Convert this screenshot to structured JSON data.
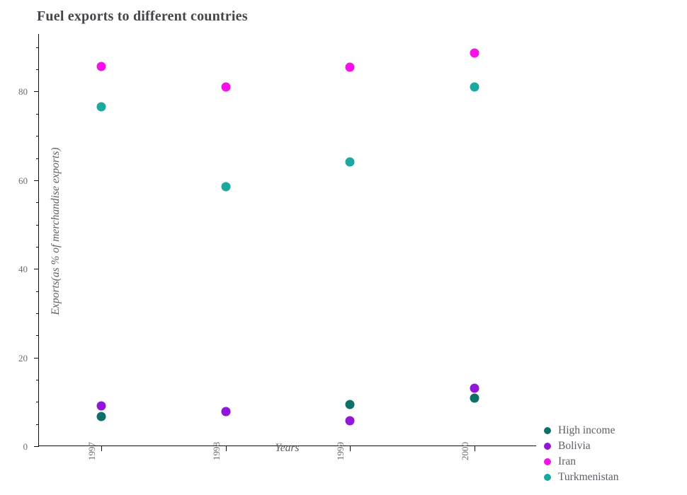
{
  "chart_data": {
    "type": "scatter",
    "title": "Fuel exports to different countries",
    "xlabel": "Years",
    "ylabel": "Exports(as % of merchandise exports)",
    "categories": [
      "1997",
      "1998",
      "1999",
      "2000"
    ],
    "ylim": [
      0,
      93
    ],
    "yticks": [
      0,
      20,
      40,
      60,
      80
    ],
    "ytick_labels": [
      "0",
      "20",
      "40",
      "60",
      "80"
    ],
    "yminor_step": 5,
    "grid": false,
    "legend_position": "right-bottom",
    "series": [
      {
        "name": "High income",
        "color": "#0e7069",
        "values": [
          6.68,
          7.82,
          9.45,
          10.92
        ]
      },
      {
        "name": "Bolivia",
        "color": "#9117d8",
        "values": [
          9.15,
          7.88,
          5.7,
          13.15
        ]
      },
      {
        "name": "Iran",
        "color": "#f711e8",
        "values": [
          85.7,
          81.05,
          85.5,
          88.7
        ]
      },
      {
        "name": "Turkmenistan",
        "color": "#1aa8a0",
        "values": [
          76.5,
          58.5,
          64.15,
          81.0
        ]
      }
    ]
  }
}
